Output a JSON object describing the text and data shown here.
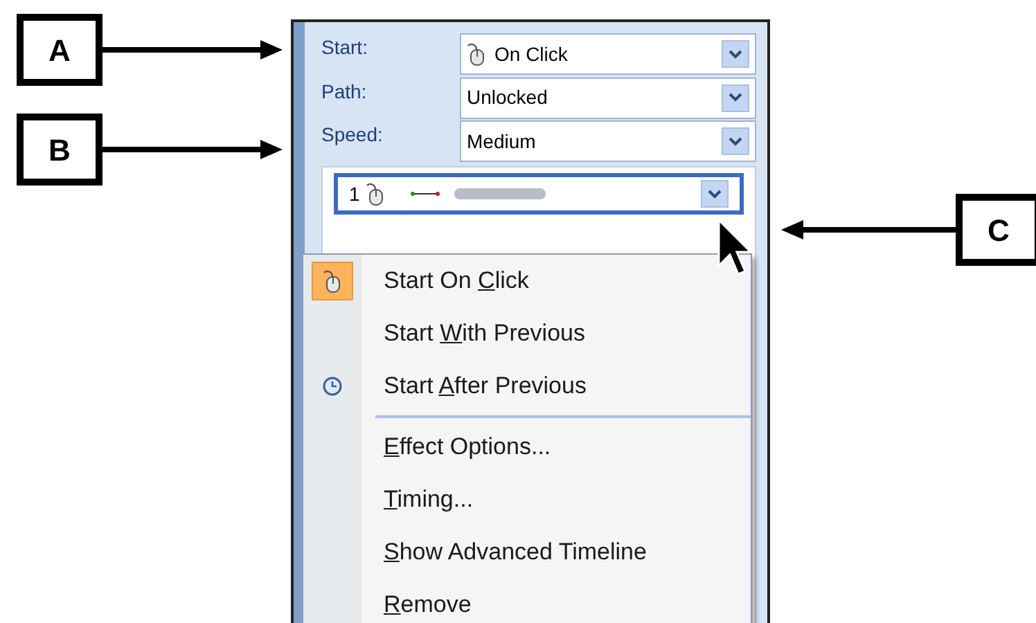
{
  "annotations": [
    {
      "label": "A"
    },
    {
      "label": "B"
    },
    {
      "label": "C"
    }
  ],
  "fields": [
    {
      "label": "Start:",
      "value": "On Click",
      "kind": "mouse"
    },
    {
      "label": "Path:",
      "value": "Unlocked",
      "kind": "plain"
    },
    {
      "label": "Speed:",
      "value": "Medium",
      "kind": "plain"
    }
  ],
  "effect_list": [
    {
      "number": "1",
      "selected": true
    }
  ],
  "menu": [
    {
      "before": "Start On ",
      "key": "C",
      "after": "lick",
      "kind": "mouse",
      "checked": true,
      "separator_before": false
    },
    {
      "before": "Start ",
      "key": "W",
      "after": "ith Previous",
      "kind": "plain",
      "checked": false,
      "separator_before": false
    },
    {
      "before": "Start ",
      "key": "A",
      "after": "fter Previous",
      "kind": "clock",
      "checked": false,
      "separator_before": false
    },
    {
      "key": "E",
      "after": "ffect Options...",
      "kind": "plain",
      "checked": false,
      "separator_before": true
    },
    {
      "key": "T",
      "after": "iming...",
      "kind": "plain",
      "checked": false,
      "separator_before": false
    },
    {
      "key": "S",
      "after": "how Advanced Timeline",
      "kind": "plain",
      "checked": false,
      "separator_before": false
    },
    {
      "key": "R",
      "after": "emove",
      "kind": "plain",
      "checked": false,
      "separator_before": false
    }
  ]
}
